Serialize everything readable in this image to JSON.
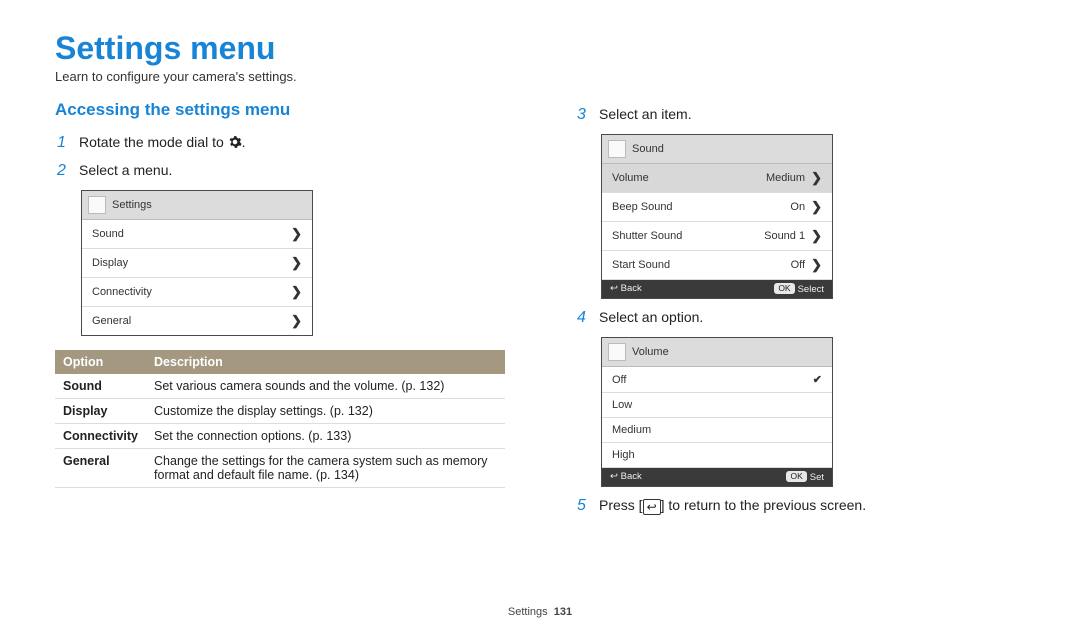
{
  "page": {
    "title": "Settings menu",
    "subtitle": "Learn to configure your camera's settings."
  },
  "section_heading": "Accessing the settings menu",
  "steps": {
    "s1": {
      "num": "1",
      "text_prefix": "Rotate the mode dial to ",
      "text_suffix": "."
    },
    "s2": {
      "num": "2",
      "text": "Select a menu."
    },
    "s3": {
      "num": "3",
      "text": "Select an item."
    },
    "s4": {
      "num": "4",
      "text": "Select an option."
    },
    "s5": {
      "num": "5",
      "text_prefix": "Press [",
      "text_suffix": "] to return to the previous screen."
    }
  },
  "screen1": {
    "header": "Settings",
    "rows": [
      "Sound",
      "Display",
      "Connectivity",
      "General"
    ]
  },
  "screen2": {
    "header": "Sound",
    "rows": [
      {
        "label": "Volume",
        "value": "Medium",
        "selected": true
      },
      {
        "label": "Beep Sound",
        "value": "On"
      },
      {
        "label": "Shutter Sound",
        "value": "Sound 1"
      },
      {
        "label": "Start Sound",
        "value": "Off"
      }
    ],
    "foot_back": "Back",
    "foot_ok_key": "OK",
    "foot_ok": "Select"
  },
  "screen3": {
    "header": "Volume",
    "rows": [
      {
        "label": "Off",
        "selected": true
      },
      {
        "label": "Low"
      },
      {
        "label": "Medium"
      },
      {
        "label": "High"
      }
    ],
    "foot_back": "Back",
    "foot_ok_key": "OK",
    "foot_ok": "Set"
  },
  "options_table": {
    "headers": [
      "Option",
      "Description"
    ],
    "rows": [
      {
        "opt": "Sound",
        "desc": "Set various camera sounds and the volume. (p. 132)"
      },
      {
        "opt": "Display",
        "desc": "Customize the display settings. (p. 132)"
      },
      {
        "opt": "Connectivity",
        "desc": "Set the connection options. (p. 133)"
      },
      {
        "opt": "General",
        "desc": "Change the settings for the camera system such as memory format and default file name. (p. 134)"
      }
    ]
  },
  "footer": {
    "section": "Settings",
    "page_num": "131"
  }
}
